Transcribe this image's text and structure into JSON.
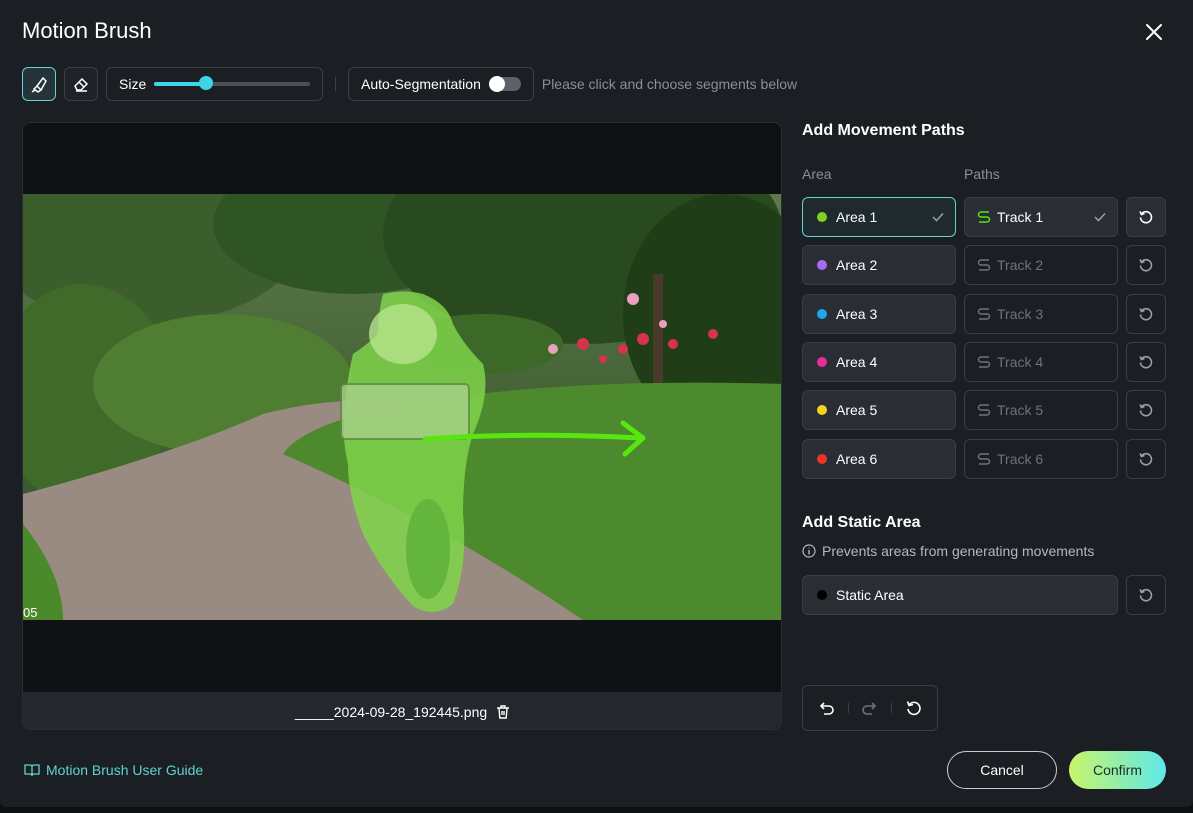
{
  "header": {
    "title": "Motion Brush",
    "close_icon": "close-icon"
  },
  "toolbar": {
    "brush_icon": "brush-icon",
    "eraser_icon": "eraser-icon",
    "size_label": "Size",
    "size_value": 0.33,
    "autoseg_label": "Auto-Segmentation",
    "autoseg_on": false,
    "hint": "Please click and choose segments below"
  },
  "canvas": {
    "frame_label": "05",
    "filename": "_____2024-09-28_192445.png",
    "delete_icon": "trash-icon"
  },
  "panel": {
    "movement_title": "Add Movement Paths",
    "area_header": "Area",
    "paths_header": "Paths",
    "rows": [
      {
        "area": "Area 1",
        "color": "#7ed321",
        "track": "Track 1",
        "selected": true
      },
      {
        "area": "Area 2",
        "color": "#a66cf2",
        "track": "Track 2",
        "selected": false
      },
      {
        "area": "Area 3",
        "color": "#1ea7ef",
        "track": "Track 3",
        "selected": false
      },
      {
        "area": "Area 4",
        "color": "#ea2b9a",
        "track": "Track 4",
        "selected": false
      },
      {
        "area": "Area 5",
        "color": "#f6d21a",
        "track": "Track 5",
        "selected": false
      },
      {
        "area": "Area 6",
        "color": "#ee3424",
        "track": "Track 6",
        "selected": false
      }
    ],
    "static_title": "Add Static Area",
    "static_note": "Prevents areas from generating movements",
    "static_area": "Static Area"
  },
  "footer": {
    "guide": "Motion Brush User Guide",
    "cancel": "Cancel",
    "confirm": "Confirm"
  },
  "colors": {
    "accent": "#5fd4d0",
    "path_green": "#57e60f"
  }
}
